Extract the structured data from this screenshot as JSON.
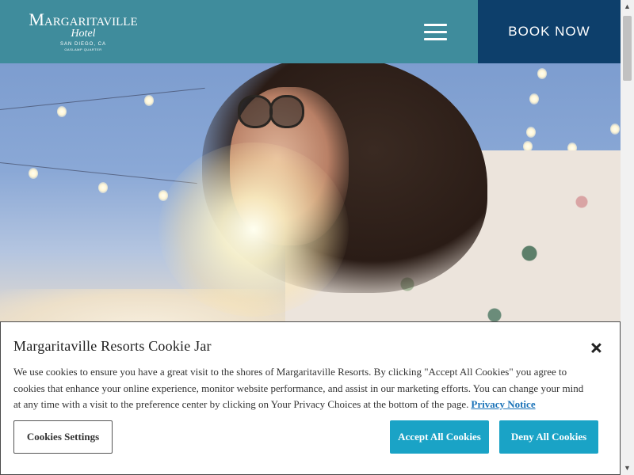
{
  "header": {
    "logo": {
      "main": "Margaritaville",
      "script": "Hotel",
      "location": "SAN DIEGO, CA",
      "district": "GASLAMP QUARTER"
    },
    "menu_icon": "hamburger-menu-icon",
    "book_now_label": "BOOK NOW",
    "colors": {
      "header_bg": "#3f8c9c",
      "book_now_bg": "#0d3f6b"
    }
  },
  "cookie_banner": {
    "title": "Margaritaville Resorts Cookie Jar",
    "body": "We use cookies to ensure you have a great visit to the shores of Margaritaville Resorts. By clicking \"Accept All Cookies\" you agree to cookies that enhance your online experience, monitor website performance, and assist in our marketing efforts. You can change your mind at any time with a visit to the preference center by clicking on Your Privacy Choices at the bottom of the page.",
    "privacy_link": "Privacy Notice",
    "close_icon": "close-icon",
    "buttons": {
      "settings": "Cookies Settings",
      "accept": "Accept All Cookies",
      "deny": "Deny All Cookies"
    },
    "colors": {
      "primary_button": "#1aa3c6",
      "link": "#1b73b8"
    }
  }
}
